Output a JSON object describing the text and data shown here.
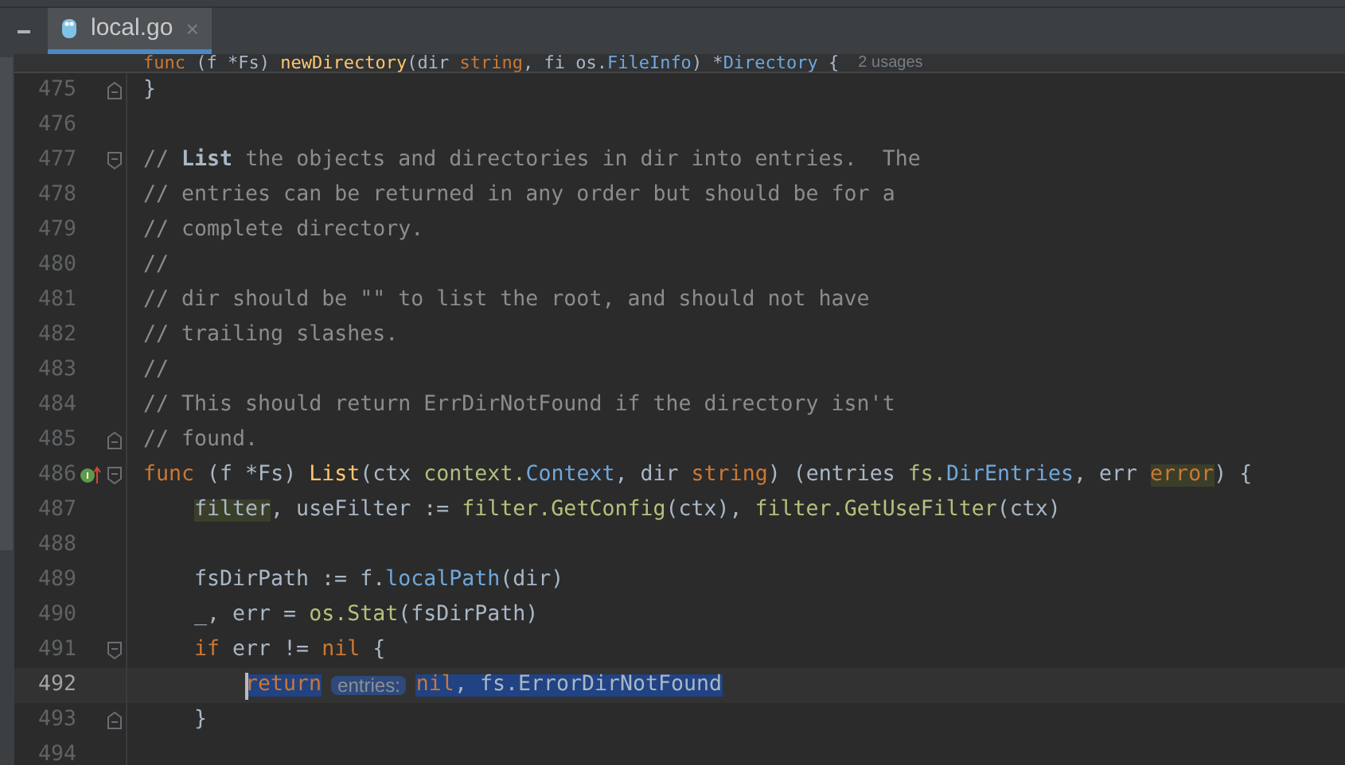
{
  "tab": {
    "label": "local.go",
    "selected": true,
    "close": "×"
  },
  "sticky_line": {
    "segments": [
      {
        "text": "func",
        "kind": "keyword"
      },
      {
        "text": " (f *Fs) ",
        "kind": "plain"
      },
      {
        "text": "newDirectory",
        "kind": "function"
      },
      {
        "text": "(dir ",
        "kind": "plain"
      },
      {
        "text": "string",
        "kind": "keyword"
      },
      {
        "text": ", fi os.",
        "kind": "plain"
      },
      {
        "text": "FileInfo",
        "kind": "type"
      },
      {
        "text": ") *",
        "kind": "plain"
      },
      {
        "text": "Directory",
        "kind": "type"
      },
      {
        "text": " {",
        "kind": "plain"
      }
    ],
    "usages": "2 usages"
  },
  "lines": [
    {
      "number": "475",
      "kind": "fold-end",
      "current": false,
      "segments": [
        {
          "text": "}",
          "kind": "plain"
        }
      ]
    },
    {
      "number": "476",
      "kind": "plain",
      "current": false
    },
    {
      "number": "477",
      "kind": "fold-start",
      "current": false,
      "segments": [
        {
          "text": "// ",
          "kind": "comment"
        },
        {
          "text": "List",
          "kind": "comment_bold"
        },
        {
          "text": " the objects and directories in dir into entries.  The",
          "kind": "comment"
        }
      ]
    },
    {
      "number": "478",
      "kind": "plain",
      "current": false,
      "segments": [
        {
          "text": "// entries can be returned in any order but should be for a",
          "kind": "comment"
        }
      ]
    },
    {
      "number": "479",
      "kind": "plain",
      "current": false,
      "segments": [
        {
          "text": "// complete directory.",
          "kind": "comment"
        }
      ]
    },
    {
      "number": "480",
      "kind": "plain",
      "current": false,
      "segments": [
        {
          "text": "//",
          "kind": "comment"
        }
      ]
    },
    {
      "number": "481",
      "kind": "plain",
      "current": false,
      "segments": [
        {
          "text": "// dir should be \"\" to list the root, and should not have",
          "kind": "comment"
        }
      ]
    },
    {
      "number": "482",
      "kind": "plain",
      "current": false,
      "segments": [
        {
          "text": "// trailing slashes.",
          "kind": "comment"
        }
      ]
    },
    {
      "number": "483",
      "kind": "plain",
      "current": false,
      "segments": [
        {
          "text": "//",
          "kind": "comment"
        }
      ]
    },
    {
      "number": "484",
      "kind": "plain",
      "current": false,
      "segments": [
        {
          "text": "// This should return ErrDirNotFound if the directory isn't",
          "kind": "comment"
        }
      ]
    },
    {
      "number": "485",
      "kind": "fold-end",
      "current": false,
      "segments": [
        {
          "text": "// found.",
          "kind": "comment"
        }
      ]
    },
    {
      "number": "486",
      "kind": "fold-start",
      "implements": true,
      "current": false,
      "segments": [
        {
          "text": "func",
          "kind": "keyword"
        },
        {
          "text": " (f *Fs) ",
          "kind": "plain"
        },
        {
          "text": "List",
          "kind": "function"
        },
        {
          "text": "(ctx ",
          "kind": "plain"
        },
        {
          "text": "context.",
          "kind": "package"
        },
        {
          "text": "Context",
          "kind": "type"
        },
        {
          "text": ", dir ",
          "kind": "plain"
        },
        {
          "text": "string",
          "kind": "keyword"
        },
        {
          "text": ") (entries ",
          "kind": "plain"
        },
        {
          "text": "fs.",
          "kind": "package"
        },
        {
          "text": "DirEntries",
          "kind": "type"
        },
        {
          "text": ", err ",
          "kind": "plain"
        },
        {
          "text": "error",
          "kind": "keyword",
          "highlight": true
        },
        {
          "text": ") {",
          "kind": "plain"
        }
      ],
      "children": [
        {
          "number": "487",
          "kind": "plain",
          "current": false,
          "segments": [
            {
              "text": "filter",
              "kind": "plain",
              "highlight": true
            },
            {
              "text": ", useFilter := ",
              "kind": "plain"
            },
            {
              "text": "filter.GetConfig",
              "kind": "call"
            },
            {
              "text": "(ctx), ",
              "kind": "plain"
            },
            {
              "text": "filter.GetUseFilter",
              "kind": "call"
            },
            {
              "text": "(ctx)",
              "kind": "plain"
            }
          ]
        },
        {
          "number": "488",
          "kind": "plain",
          "current": false
        },
        {
          "number": "489",
          "kind": "plain",
          "current": false,
          "segments": [
            {
              "text": "fsDirPath := f.",
              "kind": "plain"
            },
            {
              "text": "localPath",
              "kind": "method"
            },
            {
              "text": "(dir)",
              "kind": "plain"
            }
          ]
        },
        {
          "number": "490",
          "kind": "plain",
          "current": false,
          "segments": [
            {
              "text": "_, err = ",
              "kind": "plain"
            },
            {
              "text": "os.Stat",
              "kind": "call"
            },
            {
              "text": "(fsDirPath)",
              "kind": "plain"
            }
          ]
        },
        {
          "number": "491",
          "kind": "fold-start",
          "current": false,
          "segments": [
            {
              "text": "if",
              "kind": "keyword"
            },
            {
              "text": " err != ",
              "kind": "plain"
            },
            {
              "text": "nil",
              "kind": "keyword"
            },
            {
              "text": " {",
              "kind": "plain"
            }
          ],
          "children": [
            {
              "number": "492",
              "current": true,
              "segments": [
                {
                  "text": "return",
                  "kind": "keyword",
                  "selected": true
                },
                {
                  "text": "entries:",
                  "kind": "hint",
                  "selected": true
                },
                {
                  "text": "nil",
                  "kind": "keyword",
                  "selected": true
                },
                {
                  "text": ", fs.ErrorDirNotFound",
                  "kind": "plain",
                  "selected": true
                }
              ]
            }
          ]
        },
        {
          "number": "493",
          "kind": "fold-end",
          "current": false,
          "segments": [
            {
              "text": "}",
              "kind": "plain"
            }
          ]
        }
      ]
    },
    {
      "number": "494",
      "kind": "plain",
      "current": false
    }
  ]
}
